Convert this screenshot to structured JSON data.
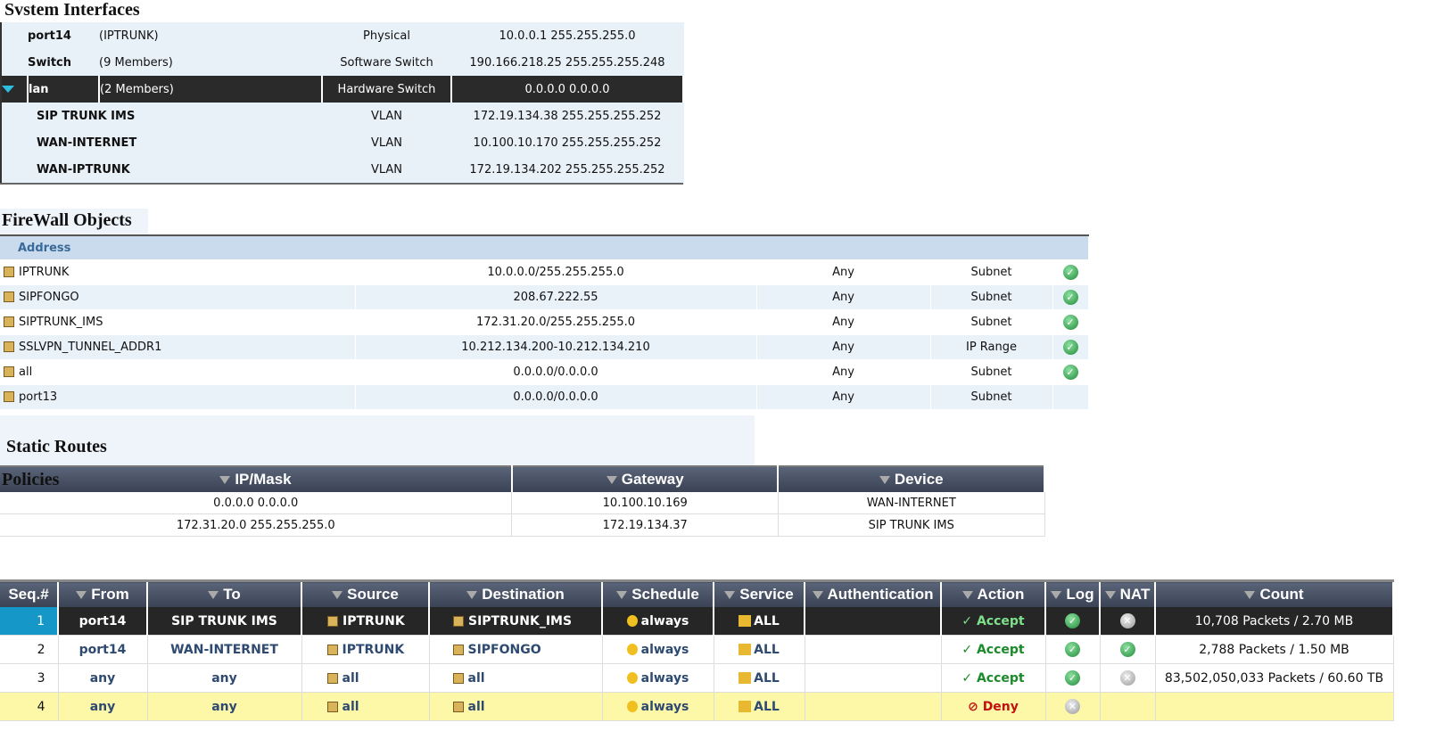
{
  "system_interfaces": {
    "title": "Svstem Interfaces",
    "rows": [
      {
        "name": "port14",
        "detail": "(IPTRUNK)",
        "type": "Physical",
        "ip": "10.0.0.1 255.255.255.0"
      },
      {
        "name": "Switch",
        "detail": "(9 Members)",
        "type": "Software Switch",
        "ip": "190.166.218.25 255.255.255.248"
      },
      {
        "name": "lan",
        "detail": "(2 Members)",
        "type": "Hardware Switch",
        "ip": "0.0.0.0 0.0.0.0",
        "selected": true
      },
      {
        "name": "SIP TRUNK IMS",
        "detail": "",
        "type": "VLAN",
        "ip": "172.19.134.38 255.255.255.252"
      },
      {
        "name": "WAN-INTERNET",
        "detail": "",
        "type": "VLAN",
        "ip": "10.100.10.170 255.255.255.252"
      },
      {
        "name": "WAN-IPTRUNK",
        "detail": "",
        "type": "VLAN",
        "ip": "172.19.134.202 255.255.255.252"
      }
    ]
  },
  "firewall_objects": {
    "title": "FireWall Objects",
    "band": "Address",
    "rows": [
      {
        "name": "IPTRUNK",
        "address": "10.0.0.0/255.255.255.0",
        "interface": "Any",
        "type": "Subnet",
        "status": "ok"
      },
      {
        "name": "SIPFONGO",
        "address": "208.67.222.55",
        "interface": "Any",
        "type": "Subnet",
        "status": "ok"
      },
      {
        "name": "SIPTRUNK_IMS",
        "address": "172.31.20.0/255.255.255.0",
        "interface": "Any",
        "type": "Subnet",
        "status": "ok"
      },
      {
        "name": "SSLVPN_TUNNEL_ADDR1",
        "address": "10.212.134.200-10.212.134.210",
        "interface": "Any",
        "type": "IP Range",
        "status": "ok"
      },
      {
        "name": "all",
        "address": "0.0.0.0/0.0.0.0",
        "interface": "Any",
        "type": "Subnet",
        "status": "ok"
      },
      {
        "name": "port13",
        "address": "0.0.0.0/0.0.0.0",
        "interface": "Any",
        "type": "Subnet",
        "status": ""
      }
    ]
  },
  "static_routes": {
    "title": "Static Routes",
    "overlay": "Policies",
    "headers": [
      "IP/Mask",
      "Gateway",
      "Device"
    ],
    "rows": [
      [
        "0.0.0.0 0.0.0.0",
        "10.100.10.169",
        "WAN-INTERNET"
      ],
      [
        "172.31.20.0 255.255.255.0",
        "172.19.134.37",
        "SIP TRUNK IMS"
      ]
    ]
  },
  "policies": {
    "headers": [
      "Seq.#",
      "From",
      "To",
      "Source",
      "Destination",
      "Schedule",
      "Service",
      "Authentication",
      "Action",
      "Log",
      "NAT",
      "Count"
    ],
    "rows": [
      {
        "seq": "1",
        "from": "port14",
        "to": "SIP TRUNK IMS",
        "source": "IPTRUNK",
        "dest": "SIPTRUNK_IMS",
        "schedule": "always",
        "service": "ALL",
        "auth": "",
        "action": "Accept",
        "log": "ok",
        "nat": "off",
        "count": "10,708 Packets / 2.70 MB"
      },
      {
        "seq": "2",
        "from": "port14",
        "to": "WAN-INTERNET",
        "source": "IPTRUNK",
        "dest": "SIPFONGO",
        "schedule": "always",
        "service": "ALL",
        "auth": "",
        "action": "Accept",
        "log": "ok",
        "nat": "ok",
        "count": "2,788 Packets / 1.50 MB"
      },
      {
        "seq": "3",
        "from": "any",
        "to": "any",
        "source": "all",
        "dest": "all",
        "schedule": "always",
        "service": "ALL",
        "auth": "",
        "action": "Accept",
        "log": "ok",
        "nat": "off",
        "count": "83,502,050,033 Packets / 60.60 TB"
      },
      {
        "seq": "4",
        "from": "any",
        "to": "any",
        "source": "all",
        "dest": "all",
        "schedule": "always",
        "service": "ALL",
        "auth": "",
        "action": "Deny",
        "log": "off",
        "nat": "",
        "count": ""
      }
    ]
  },
  "colors": {
    "selected_row": "#262626",
    "seq_highlight": "#1597c8",
    "deny_row": "#fdf8a8",
    "accept": "#1a8a2a",
    "deny": "#c01010",
    "header": "#4a5366"
  }
}
